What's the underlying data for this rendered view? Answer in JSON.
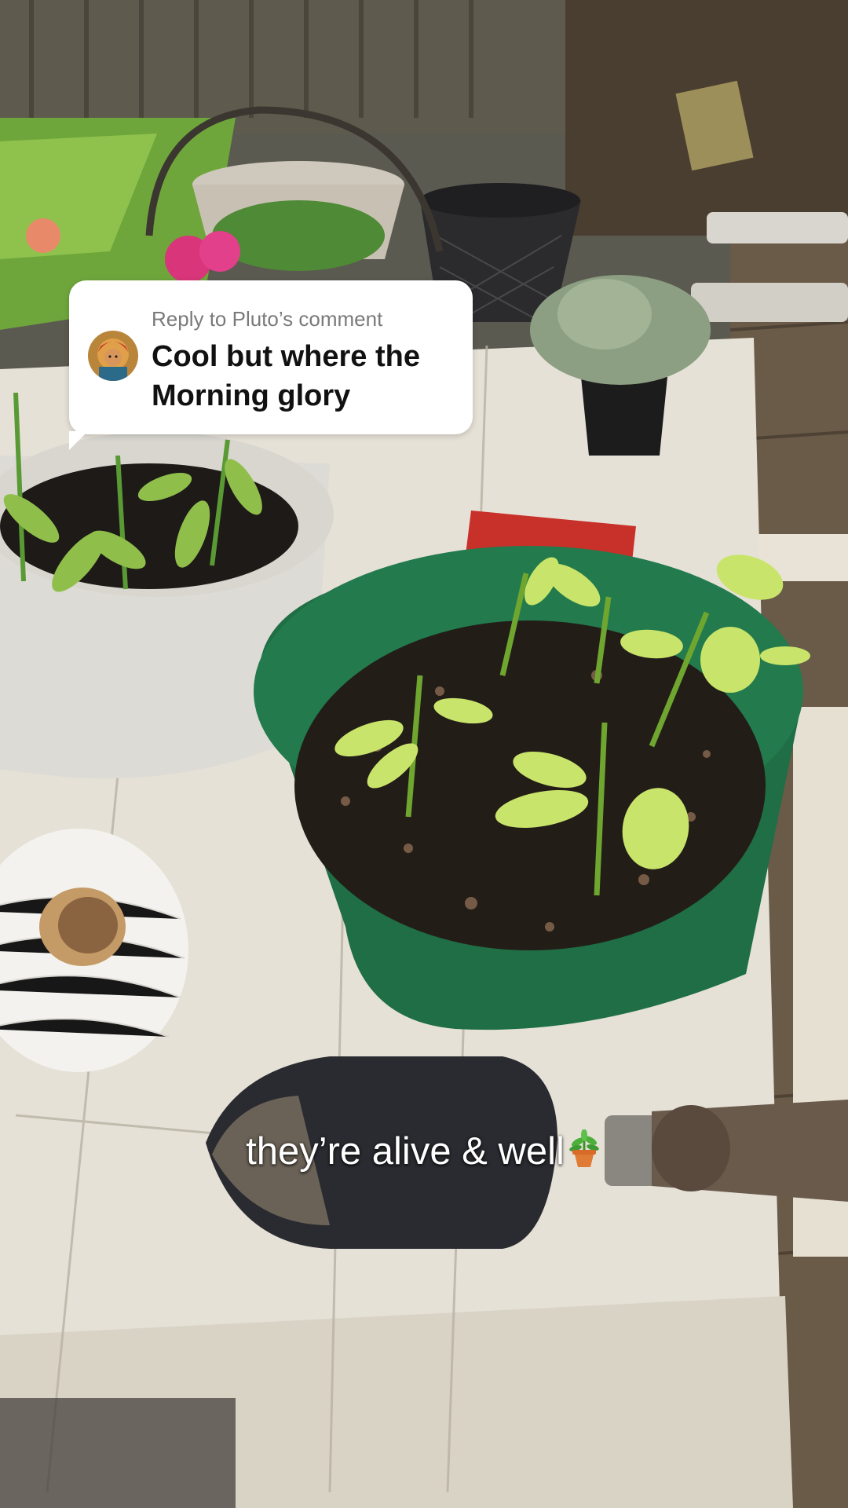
{
  "reply_card": {
    "label": "Reply to Pluto’s comment",
    "text": "Cool but where the Morning glory"
  },
  "caption": {
    "text": "they’re alive & well",
    "emoji": "potted-plant-icon"
  },
  "colors": {
    "card_bg": "#ffffff",
    "reply_label": "#7a7a7a",
    "reply_text": "#111111",
    "caption_text": "#ffffff",
    "pot_green": "#1f6e45"
  }
}
